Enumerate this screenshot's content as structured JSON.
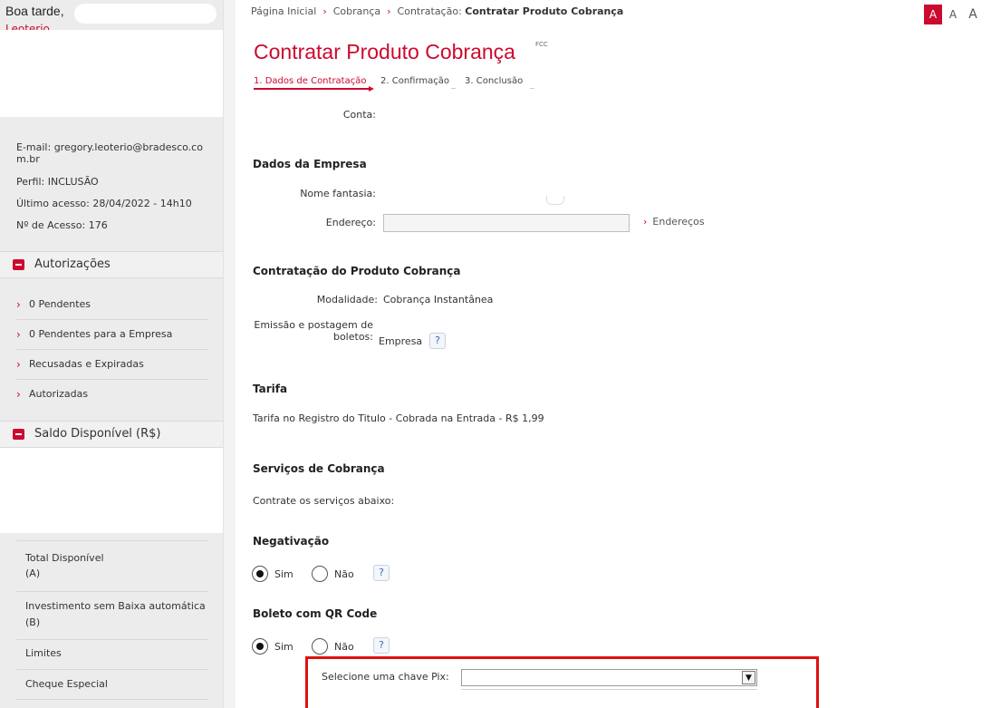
{
  "sidebar": {
    "greeting": "Boa tarde,",
    "user_name": "Leoterio",
    "email": "E-mail: gregory.leoterio@bradesco.co",
    "email_cont": "m.br",
    "profile": "Perfil: INCLUSÃO",
    "last_access": "Último acesso: 28/04/2022 - 14h10",
    "access_count": "Nº de Acesso: 176",
    "authorizations": {
      "title": "Autorizações",
      "items": [
        {
          "label": "0 Pendentes"
        },
        {
          "label": "0 Pendentes para a Empresa"
        },
        {
          "label": "Recusadas e Expiradas"
        },
        {
          "label": "Autorizadas"
        }
      ]
    },
    "balance": {
      "title": "Saldo Disponível (R$)",
      "items": [
        {
          "label": "Total Disponível",
          "sub": "(A)"
        },
        {
          "label": "Investimento sem Baixa automática",
          "sub": "(B)"
        },
        {
          "label": "Limites"
        },
        {
          "label": "Cheque Especial"
        }
      ]
    }
  },
  "breadcrumb": {
    "home": "Página Inicial",
    "level1": "Cobrança",
    "current_prefix": "Contratação:",
    "current": "Contratar Produto Cobrança"
  },
  "font_controls": [
    "A",
    "A",
    "A"
  ],
  "page": {
    "title": "Contratar Produto Cobrança",
    "code": "FCC"
  },
  "steps": [
    {
      "label": "1. Dados de Contratação",
      "active": true
    },
    {
      "label": "2. Confirmação",
      "active": false
    },
    {
      "label": "3. Conclusão",
      "active": false
    }
  ],
  "form": {
    "conta_label": "Conta:",
    "empresa": {
      "title": "Dados da Empresa",
      "nome_fantasia_label": "Nome fantasia:",
      "endereco_label": "Endereço:",
      "endereco_value": "",
      "enderecos_link": "Endereços"
    },
    "produto": {
      "title": "Contratação do Produto Cobrança",
      "modalidade_label": "Modalidade:",
      "modalidade_value": "Cobrança Instantânea",
      "emissao_label_1": "Emissão e postagem de",
      "emissao_label_2": "boletos:",
      "emissao_value": "Empresa"
    },
    "tarifa": {
      "title": "Tarifa",
      "text": "Tarifa no Registro do Titulo - Cobrada na Entrada - R$ 1,99"
    },
    "servicos": {
      "title": "Serviços de Cobrança",
      "text": "Contrate os serviços abaixo:"
    },
    "negativacao": {
      "title": "Negativação",
      "options": [
        "Sim",
        "Não"
      ],
      "selected": "Sim"
    },
    "qrcode": {
      "title": "Boleto com QR Code",
      "options": [
        "Sim",
        "Não"
      ],
      "selected": "Sim"
    },
    "pix": {
      "label": "Selecione uma chave Pix:",
      "selected": ""
    }
  },
  "help_icon": "?",
  "colors": {
    "brand_red": "#cc092f",
    "highlight_red": "#e01010",
    "help_blue": "#3a6ab8"
  }
}
